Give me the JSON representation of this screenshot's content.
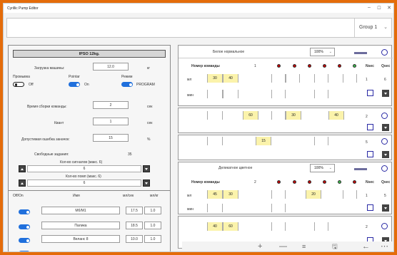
{
  "window": {
    "title": "Cyrillic Pump Editor",
    "minimize": "–",
    "maximize": "☐",
    "close": "✕"
  },
  "topbar": {
    "group": "Group 1",
    "group_chevron": "⌄"
  },
  "left": {
    "header": "IPSO 12kg.",
    "load_label": "Загрузка машины:",
    "load_value": "12.0",
    "load_unit": "кг",
    "wash_label": "Промывка",
    "wash_state": "Off",
    "pointar_label": "Pointar",
    "pointar_state": "On",
    "mode_label": "Режим",
    "mode_state": "PROGRAM",
    "cmd_time_label": "Время сборки команды:",
    "cmd_time_value": "2",
    "cmd_time_unit": "сек",
    "kvant_label": "Квант",
    "kvant_value": "1",
    "kvant_unit": "сек",
    "err_label": "Допустимая ошибка заначок:",
    "err_value": "15",
    "err_unit": "%",
    "free_label": "Свободные задания:",
    "free_value": "35",
    "signals_label": "Кол-во сигналов (макс. 6)",
    "signals_value": "6",
    "pumps_label": "Кол-во помп (макс. 6)",
    "pumps_value": "6",
    "cols": {
      "onoff": "Off/On",
      "name": "Имя",
      "mlsec": "мл/сек",
      "mlkg": "мл/кг"
    },
    "pumps": [
      {
        "name": "Мб/М1",
        "mlsec": "17.5",
        "mlkg": "1.0"
      },
      {
        "name": "Палика",
        "mlsec": "18.5",
        "mlkg": "1.0"
      },
      {
        "name": "Веланс 8",
        "mlsec": "10.0",
        "mlkg": "1.0"
      }
    ]
  },
  "blocks": [
    {
      "title": "Белое нормальное",
      "zoom": "100%",
      "cmd_label": "Номер команды",
      "cmd_num": "1",
      "nsec": "Nsec",
      "qsec": "Qsec",
      "row_ml": "мл",
      "row_min": "мин",
      "vals": [
        "30",
        "40"
      ],
      "nsec_val": "1",
      "qsec_val": "6"
    },
    {
      "vals": [
        "60",
        "30",
        "40"
      ],
      "nsec_val": "2"
    },
    {
      "vals": [
        "15"
      ],
      "nsec_val": "5"
    },
    {
      "title": "Деликатное цветное",
      "zoom": "100%",
      "cmd_label": "Номер команды",
      "cmd_num": "2",
      "nsec": "Nsec",
      "qsec": "Qsec",
      "row_ml": "мл",
      "row_min": "мин",
      "vals": [
        "45",
        "30",
        "20"
      ],
      "nsec_val": "1",
      "qsec_val": "5"
    },
    {
      "vals": [
        "40",
        "60"
      ],
      "nsec_val": "2"
    }
  ],
  "bottom": {
    "add": "+",
    "remove": "—",
    "list": "≡",
    "save": "🖫",
    "back": "←",
    "more": "⋯"
  },
  "colors": {
    "frame": "#e46c0a",
    "toggle_on": "#1f6fdc",
    "yellow": "#fbf3ab",
    "accent_blue": "#2a2aa5"
  }
}
